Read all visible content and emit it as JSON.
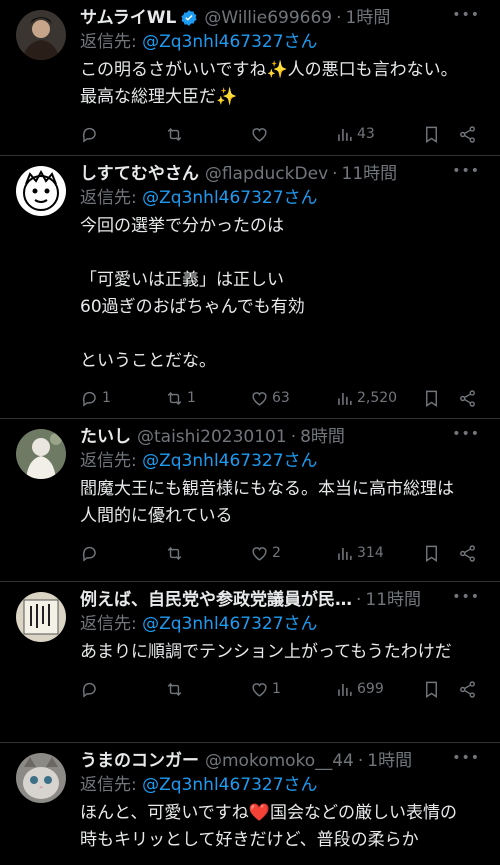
{
  "tweets": [
    {
      "name": "サムライWL",
      "verified": true,
      "handle": "@Willie699669",
      "time": "1時間",
      "reply_prefix": "返信先: ",
      "reply_to": "@Zq3nhl467327さん",
      "text": "この明るさがいいですね✨人の悪口も言わない。最高な総理大臣だ✨",
      "replies": "",
      "retweets": "",
      "likes": "",
      "views": "43"
    },
    {
      "name": "しすてむやさん",
      "verified": false,
      "handle": "@flapduckDev",
      "time": "11時間",
      "reply_prefix": "返信先: ",
      "reply_to": "@Zq3nhl467327さん",
      "text": "今回の選挙で分かったのは\n\n「可愛いは正義」は正しい\n60過ぎのおばちゃんでも有効\n\nということだな。",
      "replies": "1",
      "retweets": "1",
      "likes": "63",
      "views": "2,520"
    },
    {
      "name": "たいし",
      "verified": false,
      "handle": "@taishi20230101",
      "time": "8時間",
      "reply_prefix": "返信先: ",
      "reply_to": "@Zq3nhl467327さん",
      "text": "閻魔大王にも観音様にもなる。本当に高市総理は人間的に優れている",
      "replies": "",
      "retweets": "",
      "likes": "2",
      "views": "314"
    },
    {
      "name": "例えば、自民党や参政党議員が民…",
      "verified": false,
      "handle": "",
      "time": "11時間",
      "reply_prefix": "返信先: ",
      "reply_to": "@Zq3nhl467327さん",
      "text": "あまりに順調でテンション上がってもうたわけだ",
      "replies": "",
      "retweets": "",
      "likes": "1",
      "views": "699"
    },
    {
      "name": "うまのコンガー",
      "verified": false,
      "handle": "@mokomoko__44",
      "time": "1時間",
      "reply_prefix": "返信先: ",
      "reply_to": "@Zq3nhl467327さん",
      "text": "ほんと、可愛いですね❤️国会などの厳しい表情の時もキリッとして好きだけど、普段の柔らか",
      "replies": "",
      "retweets": "",
      "likes": "",
      "views": ""
    }
  ],
  "colors": {
    "background": "#000000",
    "text": "#e7e9ea",
    "muted": "#71767b",
    "link": "#1d9bf0",
    "divider": "#2f3336"
  },
  "icons": [
    "reply-icon",
    "retweet-icon",
    "like-icon",
    "views-icon",
    "bookmark-icon",
    "share-icon",
    "more-icon",
    "verified-badge-icon"
  ]
}
